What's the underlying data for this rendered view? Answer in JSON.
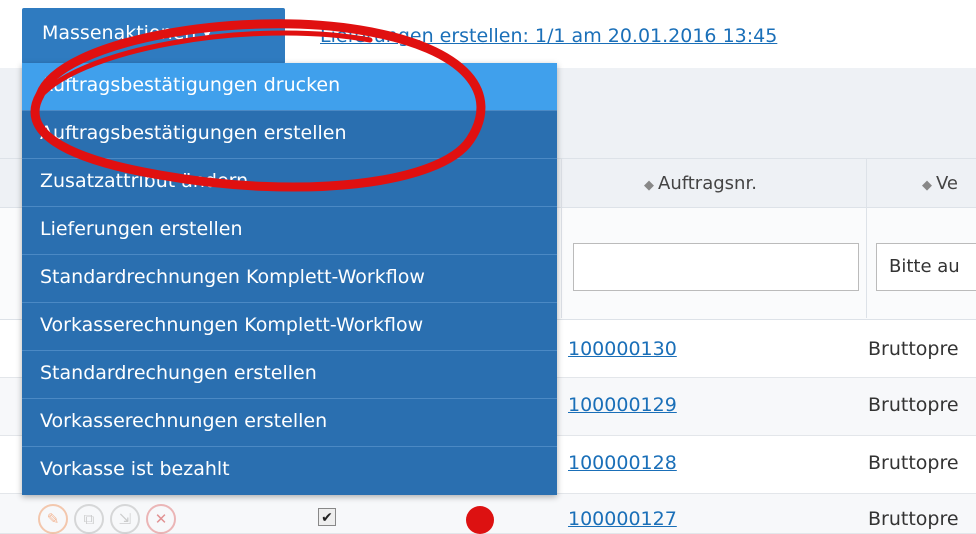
{
  "toolbar": {
    "mass_actions_label": "Massenaktionen",
    "deliveries_link": "Lieferungen erstellen: 1/1 am 20.01.2016 13:45"
  },
  "table": {
    "headers": {
      "order_no": "Auftragsnr.",
      "next_col": "Ve"
    },
    "filter": {
      "select_value": "Bitte au"
    },
    "rows": [
      {
        "order_no": "100000130",
        "type": "Bruttopre"
      },
      {
        "order_no": "100000129",
        "type": "Bruttopre"
      },
      {
        "order_no": "100000128",
        "type": "Bruttopre"
      },
      {
        "order_no": "100000127",
        "type": "Bruttopre"
      }
    ]
  },
  "menu": {
    "items": [
      "Auftragsbestätigungen drucken",
      "Auftragsbestätigungen erstellen",
      "Zusatzattribut ändern",
      "Lieferungen erstellen",
      "Standardrechnungen Komplett-Workflow",
      "Vorkasserechnungen Komplett-Workflow",
      "Standardrechungen erstellen",
      "Vorkasserechnungen erstellen",
      "Vorkasse ist bezahlt"
    ],
    "highlighted_index": 0
  },
  "colors": {
    "menu_bg": "#2a6fb0",
    "menu_highlight": "#40a0ec",
    "link": "#1a6fb8",
    "annotation": "#e01010"
  }
}
